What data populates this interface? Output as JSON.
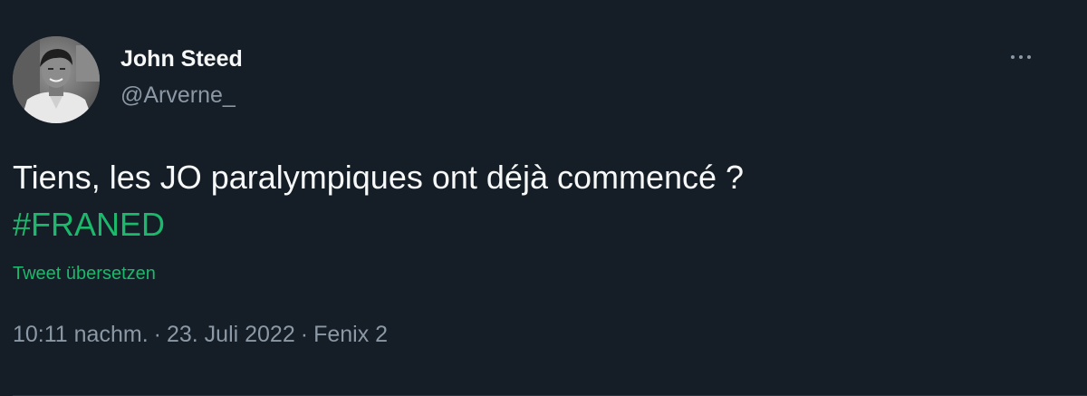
{
  "author": {
    "display_name": "John Steed",
    "handle": "@Arverne_"
  },
  "more_icon": "more-horizontal-icon",
  "tweet": {
    "text": "Tiens, les JO paralympiques ont déjà commencé ?",
    "hashtag": "#FRANED",
    "translate_label": "Tweet übersetzen"
  },
  "meta": {
    "time": "10:11 nachm.",
    "separator": "·",
    "date": "23. Juli 2022",
    "source": "Fenix 2"
  },
  "colors": {
    "background": "#151d26",
    "accent": "#1cb96c",
    "secondary_text": "#8b98a5",
    "primary_text": "#f7f9f9"
  }
}
